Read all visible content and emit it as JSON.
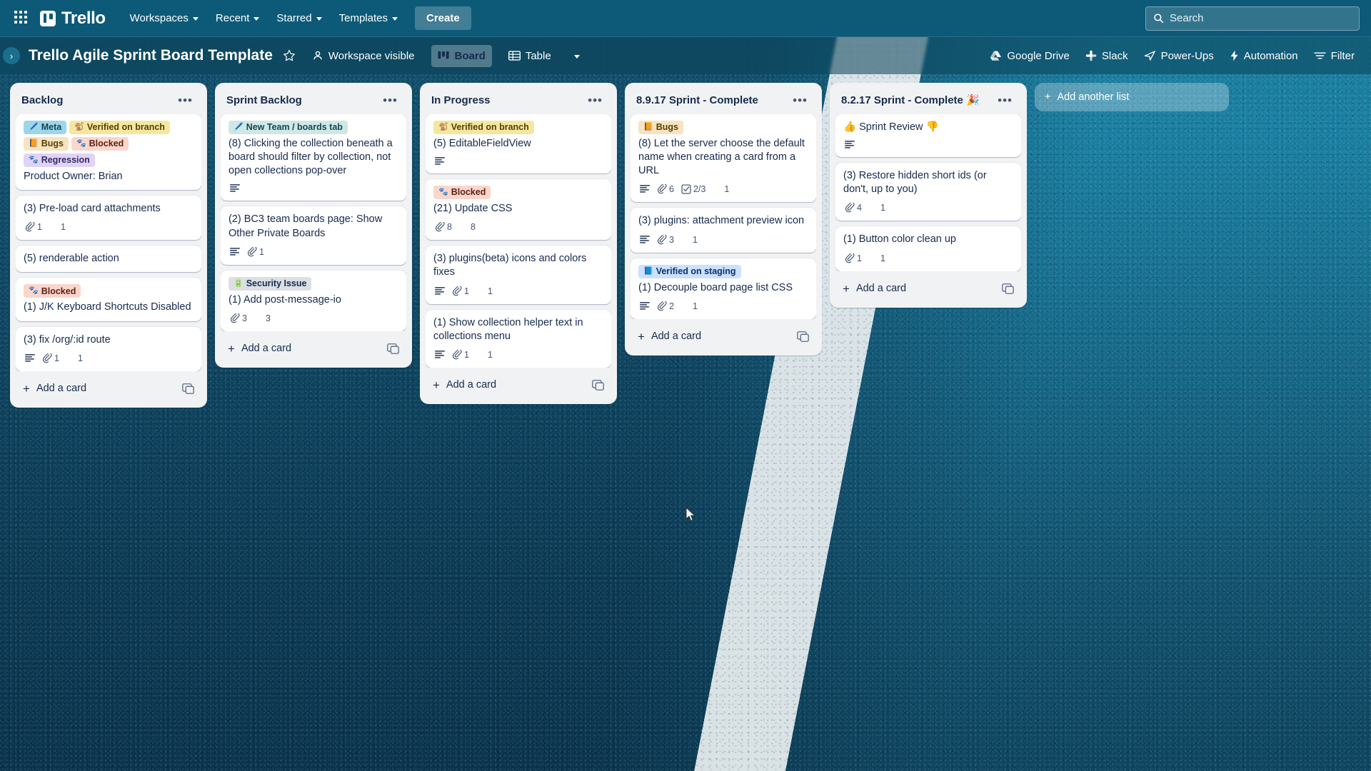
{
  "topnav": {
    "apps_icon": "apps-grid-icon",
    "brand": "Trello",
    "items": [
      {
        "label": "Workspaces",
        "caret": true
      },
      {
        "label": "Recent",
        "caret": true
      },
      {
        "label": "Starred",
        "caret": true
      },
      {
        "label": "Templates",
        "caret": true
      }
    ],
    "create_label": "Create",
    "search_placeholder": "Search"
  },
  "boardheader": {
    "title": "Trello Agile Sprint Board Template",
    "star_icon": "star-icon",
    "visibility_label": "Workspace visible",
    "views": [
      {
        "label": "Board",
        "icon": "board-icon",
        "active": true
      },
      {
        "label": "Table",
        "icon": "table-icon",
        "active": false
      }
    ],
    "more_views_icon": "chevron-down-icon",
    "right_items": [
      {
        "label": "Google Drive",
        "icon": "google-drive-icon"
      },
      {
        "label": "Slack",
        "icon": "slack-icon"
      },
      {
        "label": "Power-Ups",
        "icon": "power-ups-icon"
      },
      {
        "label": "Automation",
        "icon": "automation-bolt-icon"
      },
      {
        "label": "Filter",
        "icon": "filter-icon"
      }
    ]
  },
  "add_list_label": "Add another list",
  "add_card_label": "Add a card",
  "label_colors": {
    "Meta": {
      "bg": "#9dd6e8",
      "fg": "#164555",
      "glyph": "🖊️"
    },
    "Verified on branch": {
      "bg": "#f5e7a0",
      "fg": "#533f04",
      "glyph": "🐒"
    },
    "Bugs": {
      "bg": "#f7e3bf",
      "fg": "#533f04",
      "glyph": "📙"
    },
    "Blocked": {
      "bg": "#fbd6cc",
      "fg": "#5d1f11",
      "glyph": "🐾"
    },
    "Regression": {
      "bg": "#dfd3f7",
      "fg": "#352c63",
      "glyph": "🐾"
    },
    "New Team / boards tab": {
      "bg": "#cfe8e4",
      "fg": "#164555",
      "glyph": "🖊️"
    },
    "Security Issue": {
      "bg": "#dcdfe4",
      "fg": "#172b4d",
      "glyph": "🔋"
    },
    "Verified on staging": {
      "bg": "#cce0ff",
      "fg": "#09326c",
      "glyph": "📘"
    },
    "Sprint Review": {
      "bg": "#ffffff",
      "fg": "#172b4d",
      "glyph": "👍"
    }
  },
  "lists": [
    {
      "title": "Backlog",
      "cards": [
        {
          "labels": [
            "Meta",
            "Verified on branch",
            "Bugs",
            "Blocked",
            "Regression"
          ],
          "title": "Product Owner: Brian",
          "badges": []
        },
        {
          "labels": [],
          "title": "(3) Pre-load card attachments",
          "badges": [
            {
              "icon": "attachment-icon",
              "value": "1"
            },
            {
              "icon": "members-icon",
              "value": "1",
              "spaced": true
            }
          ]
        },
        {
          "labels": [],
          "title": "(5) renderable action",
          "badges": []
        },
        {
          "labels": [
            "Blocked"
          ],
          "title": "(1) J/K Keyboard Shortcuts Disabled",
          "badges": []
        },
        {
          "labels": [],
          "title": "(3) fix /org/:id route",
          "badges": [
            {
              "icon": "description-icon",
              "value": ""
            },
            {
              "icon": "attachment-icon",
              "value": "1"
            },
            {
              "icon": "members-icon",
              "value": "1",
              "spaced": true
            }
          ]
        }
      ]
    },
    {
      "title": "Sprint Backlog",
      "cards": [
        {
          "labels": [
            "New Team / boards tab"
          ],
          "title": "(8) Clicking the collection beneath a board should filter by collection, not open collections pop-over",
          "badges": [
            {
              "icon": "description-icon",
              "value": ""
            }
          ]
        },
        {
          "labels": [],
          "title": "(2) BC3 team boards page: Show Other Private Boards",
          "badges": [
            {
              "icon": "description-icon",
              "value": ""
            },
            {
              "icon": "attachment-icon",
              "value": "1"
            }
          ]
        },
        {
          "labels": [
            "Security Issue"
          ],
          "title": "(1) Add post-message-io",
          "badges": [
            {
              "icon": "attachment-icon",
              "value": "3"
            },
            {
              "icon": "members-icon",
              "value": "3",
              "spaced": true
            }
          ]
        }
      ]
    },
    {
      "title": "In Progress",
      "cards": [
        {
          "labels": [
            "Verified on branch"
          ],
          "title": "(5) EditableFieldView",
          "badges": [
            {
              "icon": "description-icon",
              "value": ""
            }
          ]
        },
        {
          "labels": [
            "Blocked"
          ],
          "title": "(21) Update CSS",
          "badges": [
            {
              "icon": "attachment-icon",
              "value": "8"
            },
            {
              "icon": "members-icon",
              "value": "8",
              "spaced": true
            }
          ]
        },
        {
          "labels": [],
          "title": "(3) plugins(beta) icons and colors fixes",
          "badges": [
            {
              "icon": "description-icon",
              "value": ""
            },
            {
              "icon": "attachment-icon",
              "value": "1"
            },
            {
              "icon": "members-icon",
              "value": "1",
              "spaced": true
            }
          ]
        },
        {
          "labels": [],
          "title": "(1) Show collection helper text in collections menu",
          "badges": [
            {
              "icon": "description-icon",
              "value": ""
            },
            {
              "icon": "attachment-icon",
              "value": "1"
            },
            {
              "icon": "members-icon",
              "value": "1",
              "spaced": true
            }
          ]
        }
      ]
    },
    {
      "title": "8.9.17 Sprint - Complete",
      "cards": [
        {
          "labels": [
            "Bugs"
          ],
          "title": "(8) Let the server choose the default name when creating a card from a URL",
          "badges": [
            {
              "icon": "description-icon",
              "value": ""
            },
            {
              "icon": "attachment-icon",
              "value": "6"
            },
            {
              "icon": "checklist-icon",
              "value": "2/3"
            },
            {
              "icon": "members-icon",
              "value": "1",
              "spaced": true
            }
          ]
        },
        {
          "labels": [],
          "title": "(3) plugins: attachment preview icon",
          "badges": [
            {
              "icon": "description-icon",
              "value": ""
            },
            {
              "icon": "attachment-icon",
              "value": "3"
            },
            {
              "icon": "members-icon",
              "value": "1",
              "spaced": true
            }
          ]
        },
        {
          "labels": [
            "Verified on staging"
          ],
          "title": "(1) Decouple board page list CSS",
          "badges": [
            {
              "icon": "description-icon",
              "value": ""
            },
            {
              "icon": "attachment-icon",
              "value": "2"
            },
            {
              "icon": "members-icon",
              "value": "1",
              "spaced": true
            }
          ]
        }
      ]
    },
    {
      "title": "8.2.17 Sprint - Complete 🎉",
      "cards": [
        {
          "labels": [],
          "title": "👍 Sprint Review 👎",
          "badges": [
            {
              "icon": "description-icon",
              "value": ""
            }
          ]
        },
        {
          "labels": [],
          "title": "(3) Restore hidden short ids (or don't, up to you)",
          "badges": [
            {
              "icon": "attachment-icon",
              "value": "4"
            },
            {
              "icon": "members-icon",
              "value": "1",
              "spaced": true
            }
          ]
        },
        {
          "labels": [],
          "title": "(1) Button color clean up",
          "badges": [
            {
              "icon": "attachment-icon",
              "value": "1"
            },
            {
              "icon": "members-icon",
              "value": "1",
              "spaced": true
            }
          ]
        }
      ]
    }
  ]
}
